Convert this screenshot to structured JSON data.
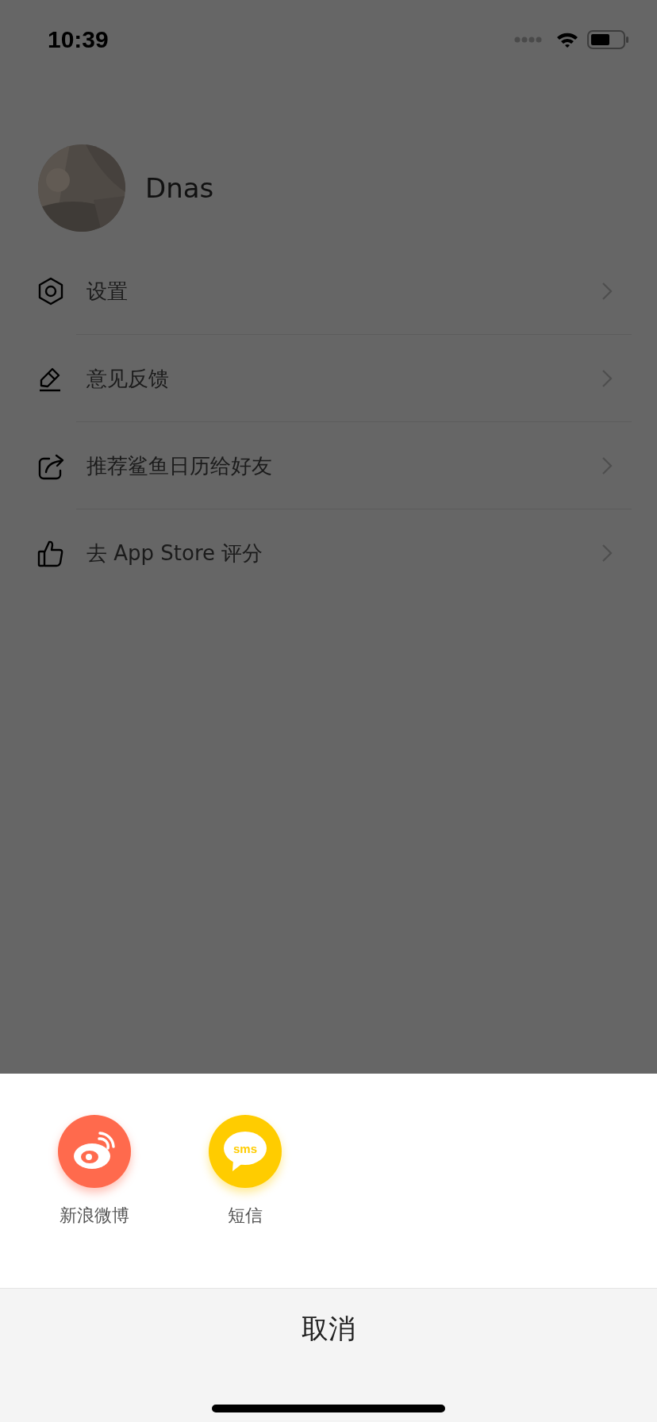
{
  "status_bar": {
    "time": "10:39"
  },
  "profile": {
    "name": "Dnas"
  },
  "menu": [
    {
      "kind": "settings",
      "label": "设置"
    },
    {
      "kind": "feedback",
      "label": "意见反馈"
    },
    {
      "kind": "share",
      "label": "推荐鲨鱼日历给好友"
    },
    {
      "kind": "rate",
      "label": "去 App Store 评分"
    }
  ],
  "share_sheet": {
    "targets": [
      {
        "kind": "weibo",
        "label": "新浪微博",
        "color": "#ff6a4d"
      },
      {
        "kind": "sms",
        "label": "短信",
        "color": "#ffcc00",
        "icon_text": "sms"
      }
    ],
    "cancel": "取消"
  }
}
